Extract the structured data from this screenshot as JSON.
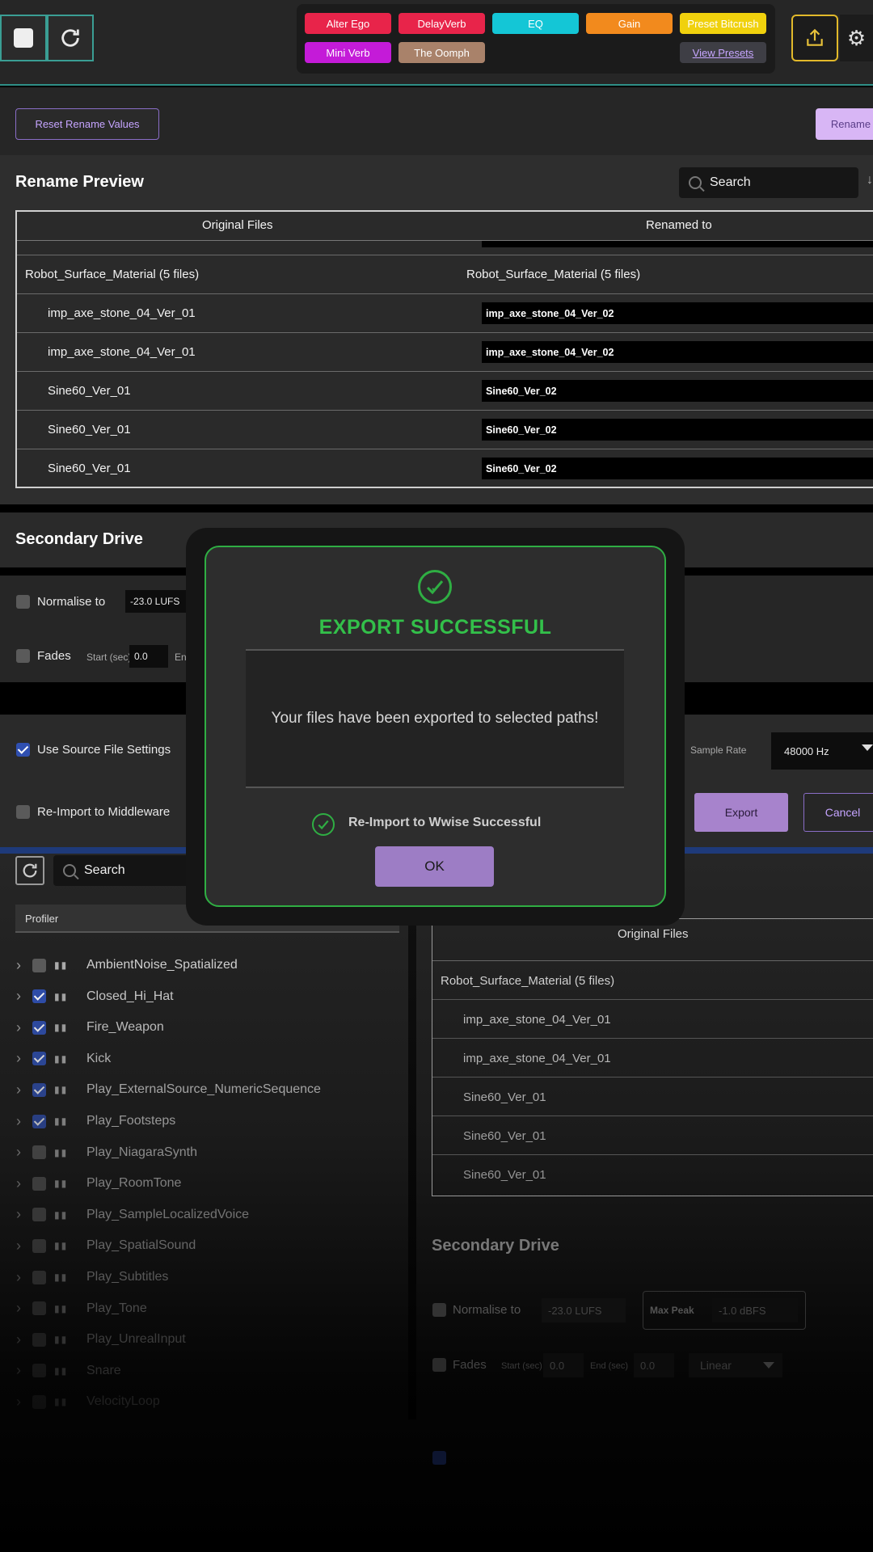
{
  "presets": {
    "row1": [
      {
        "label": "Alter Ego",
        "color": "#e8244a"
      },
      {
        "label": "DelayVerb",
        "color": "#e8244a"
      },
      {
        "label": "EQ",
        "color": "#14c6d6"
      },
      {
        "label": "Gain",
        "color": "#f28a1d"
      },
      {
        "label": "Preset Bitcrush",
        "color": "#f0d10d"
      }
    ],
    "row2": [
      {
        "label": "Mini Verb",
        "color": "#c41bd8"
      },
      {
        "label": "The Oomph",
        "color": "#a9826a"
      }
    ],
    "view_label": "View Presets"
  },
  "rename": {
    "reset_label": "Reset Rename Values",
    "rename_label": "Rename",
    "title": "Rename Preview",
    "search_placeholder": "Search",
    "col_original": "Original Files",
    "col_renamed": "Renamed to",
    "group": "Robot_Surface_Material (5 files)",
    "rows": [
      {
        "orig": "imp_axe_stone_04_Ver_01",
        "ren": "imp_axe_stone_04_Ver_02"
      },
      {
        "orig": "imp_axe_stone_04_Ver_01",
        "ren": "imp_axe_stone_04_Ver_02"
      },
      {
        "orig": "Sine60_Ver_01",
        "ren": "Sine60_Ver_02"
      },
      {
        "orig": "Sine60_Ver_01",
        "ren": "Sine60_Ver_02"
      },
      {
        "orig": "Sine60_Ver_01",
        "ren": "Sine60_Ver_02"
      }
    ]
  },
  "drive": {
    "title": "Secondary Drive",
    "normalise_label": "Normalise to",
    "normalise_value": "-23.0 LUFS",
    "fades_label": "Fades",
    "start_label": "Start (sec)",
    "start_value": "0.0",
    "end_label_partial": "En"
  },
  "export_row": {
    "use_source_label": "Use Source File Settings",
    "reimport_label": "Re-Import to Middleware",
    "sample_rate_label": "Sample Rate",
    "sample_rate_value": "48000 Hz",
    "export_label": "Export",
    "cancel_label": "Cancel"
  },
  "modal": {
    "title": "EXPORT SUCCESSFUL",
    "message": "Your files have been exported to selected paths!",
    "status": "Re-Import to Wwise Successful",
    "ok_label": "OK"
  },
  "bottom": {
    "search_placeholder": "Search",
    "profiler_label": "Profiler",
    "events": [
      {
        "name": "AmbientNoise_Spatialized",
        "checked": false
      },
      {
        "name": "Closed_Hi_Hat",
        "checked": true
      },
      {
        "name": "Fire_Weapon",
        "checked": true
      },
      {
        "name": "Kick",
        "checked": true
      },
      {
        "name": "Play_ExternalSource_NumericSequence",
        "checked": true
      },
      {
        "name": "Play_Footsteps",
        "checked": true
      },
      {
        "name": "Play_NiagaraSynth",
        "checked": false
      },
      {
        "name": "Play_RoomTone",
        "checked": false
      },
      {
        "name": "Play_SampleLocalizedVoice",
        "checked": false
      },
      {
        "name": "Play_SpatialSound",
        "checked": false
      },
      {
        "name": "Play_Subtitles",
        "checked": false
      },
      {
        "name": "Play_Tone",
        "checked": false
      },
      {
        "name": "Play_UnrealInput",
        "checked": false
      },
      {
        "name": "Snare",
        "checked": false
      },
      {
        "name": "VelocityLoop",
        "checked": false
      }
    ],
    "col_original": "Original Files",
    "group": "Robot_Surface_Material (5 files)",
    "rows": [
      "imp_axe_stone_04_Ver_01",
      "imp_axe_stone_04_Ver_01",
      "Sine60_Ver_01",
      "Sine60_Ver_01",
      "Sine60_Ver_01"
    ],
    "drive_title": "Secondary Drive",
    "normalise_label": "Normalise to",
    "normalise_value": "-23.0 LUFS",
    "max_peak_label": "Max Peak",
    "max_peak_value": "-1.0 dBFS",
    "fades_label": "Fades",
    "start_label": "Start (sec)",
    "start_value": "0.0",
    "end_label": "End (sec)",
    "end_value": "0.0",
    "curve_value": "Linear"
  }
}
